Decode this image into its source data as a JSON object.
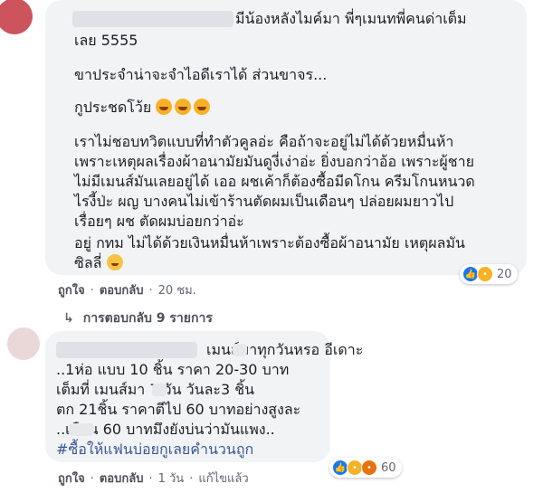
{
  "comment1": {
    "lines": [
      "มีน้องหลังไมค์มา พี่ๆเมนทพี่คนด่าเต็ม",
      "เลย 5555",
      "ขาประจำน่าจะจำไอดีเราได้ ส่วนขาจร...",
      "กูประชดโว้ย",
      "เราไม่ชอบทวิตแบบที่ทำตัวคูลอ่ะ คือถ้าจะอยู่ไม่ได้ด้วยหมื่นห้า",
      "เพราะเหตุผลเรื่องผ้าอนามัยมันดูงี่เง่าอ่ะ ยิ่งบอกว่าอ้อ เพราะผู้ชาย",
      "ไม่มีเมนส์มันเลยอยู่ได้ เออ ผชเค้าก็ต้องซื้อมีดโกน ครีมโกนหนวด",
      "ไรงี้ป่ะ ผญ บางคนไม่เข้าร้านตัดผมเป็นเดือนๆ ปล่อยผมยาวไป",
      "เรื่อยๆ ผช ตัดผมบ่อยกว่าอ่ะ",
      "อยู่ กทม ไม่ได้ด้วยเงินหมื่นห้าเพราะต้องซื้อผ้าอนามัย เหตุผลมัน",
      "ซิลลี่"
    ],
    "reaction_count": "20",
    "meta": {
      "like": "ถูกใจ",
      "reply": "ตอบกลับ",
      "time": "20 ชม."
    },
    "replies_link": "การตอบกลับ 9 รายการ"
  },
  "comment2": {
    "lines": [
      "เมนส์มาทุกวันหรอ อีเดาะ",
      "..1ห่อ แบบ 10 ชิ้น ราคา 20-30 บาท",
      "เต็มที่ เมนส์มา 7 วัน วันละ3 ชิ้น",
      "ตก 21ชิ้น ราคาตีไป 60 บาทอย่างสูงละ",
      "..เดือน 60 บาทมึงยังบ่นว่ามันแพง..",
      "#ซื้อให้แฟนบ่อยกูเลยคำนวนถูก"
    ],
    "reaction_count": "60",
    "meta": {
      "like": "ถูกใจ",
      "reply": "ตอบกลับ",
      "time": "1 วัน",
      "edited": "แก้ไขแล้ว"
    }
  },
  "colors": {
    "bubble": "#f2f3f5",
    "link": "#385898",
    "like": "#1877f2",
    "haha": "#f7b125",
    "angry": "#e9710f"
  },
  "icons": {
    "like": "like-icon",
    "haha": "haha-icon",
    "angry": "angry-icon",
    "reply_arrow": "reply-arrow-icon"
  }
}
